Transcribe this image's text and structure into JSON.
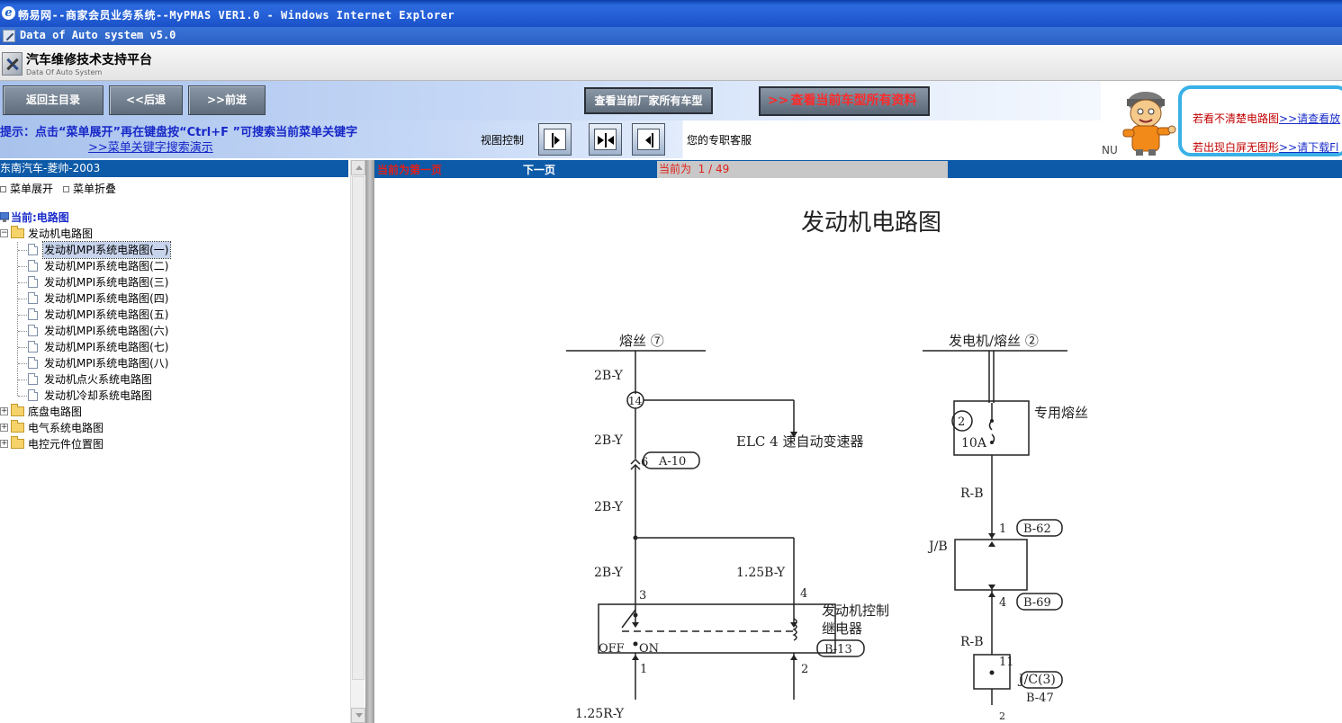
{
  "window": {
    "title": "畅易网--商家会员业务系统--MyPMAS VER1.0 - Windows Internet Explorer",
    "app_title": "Data of Auto system v5.0"
  },
  "brand": {
    "title": "汽车维修技术支持平台",
    "subtitle": "Data Of Auto System"
  },
  "toolbar": {
    "home": "返回主目录",
    "back": "<<后退",
    "forward": ">>前进",
    "view_mfr_models": "查看当前厂家所有车型",
    "view_all_data_arrow": ">>",
    "view_all_data": "查看当前车型所有资料"
  },
  "hint": {
    "text": "提示：点击“菜单展开”再在键盘按“Ctrl+F ”可搜索当前菜单关键字",
    "demo_link": ">>菜单关键字搜索演示",
    "view_control": "视图控制",
    "service": "您的专职客服"
  },
  "banner": {
    "nu": "NU",
    "line1_text": "若看不清楚电路图",
    "line1_link": ">>请查看放",
    "line2_text": "若出现白屏无图形",
    "line2_link": ">>请下载Fl"
  },
  "tree": {
    "header": "东南汽车-菱帅-2003",
    "expand": "菜单展开",
    "collapse": "菜单折叠",
    "current": "当前:电路图",
    "folders": [
      {
        "label": "发动机电路图",
        "expanded": true,
        "items": [
          "发动机MPI系统电路图(一)",
          "发动机MPI系统电路图(二)",
          "发动机MPI系统电路图(三)",
          "发动机MPI系统电路图(四)",
          "发动机MPI系统电路图(五)",
          "发动机MPI系统电路图(六)",
          "发动机MPI系统电路图(七)",
          "发动机MPI系统电路图(八)",
          "发动机点火系统电路图",
          "发动机冷却系统电路图"
        ]
      },
      {
        "label": "底盘电路图",
        "expanded": false
      },
      {
        "label": "电气系统电路图",
        "expanded": false
      },
      {
        "label": "电控元件位置图",
        "expanded": false
      }
    ]
  },
  "pager": {
    "first": "当前为第一页",
    "next": "下一页",
    "current_prefix": "当前为",
    "current": "1 / 49"
  },
  "diagram": {
    "title": "发动机电路图",
    "fuse7": "熔丝 ⑦",
    "gen_fuse": "发电机/熔丝 ②",
    "w_2by_1": "2B-Y",
    "w_2by_2": "2B-Y",
    "w_2by_3": "2B-Y",
    "w_2by_4": "2B-Y",
    "node14": "14",
    "elc": "ELC 4 速自动变速器",
    "pin6": "6",
    "conn_a10": "A-10",
    "w_125by": "1.25B-Y",
    "pin3": "3",
    "pin4a": "4",
    "relay_name_1": "发动机控制",
    "relay_name_2": "继电器",
    "conn_b13": "B-13",
    "off": "OFF",
    "on": "ON",
    "pin1a": "1",
    "pin2a": "2",
    "w_125ry": "1.25R-Y",
    "fuse_circle": "2",
    "fuse_amp": "10A",
    "fuse_dedicated": "专用熔丝",
    "w_rb_1": "R-B",
    "w_rb_2": "R-B",
    "pin1b": "1",
    "conn_b62": "B-62",
    "jb": "J/B",
    "pin4b": "4",
    "conn_b69": "B-69",
    "pin11": "11",
    "jc3": "J/C(3)",
    "conn_b47": "B-47",
    "pin2b": "2"
  }
}
